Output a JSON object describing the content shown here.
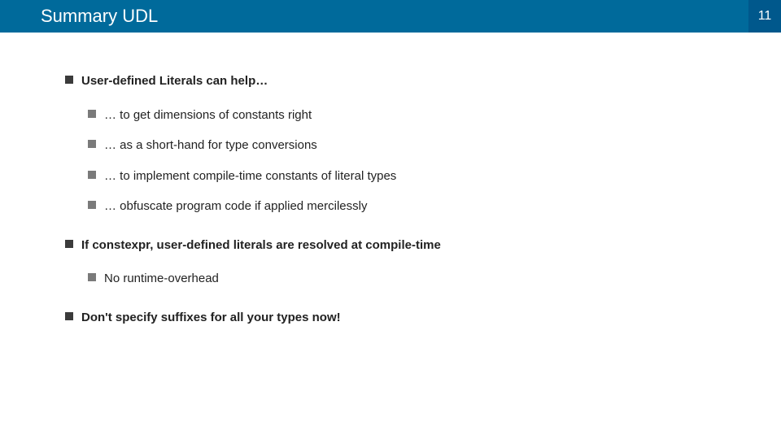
{
  "header": {
    "title": "Summary UDL",
    "page_number": "11"
  },
  "bullets": {
    "top1": "User-defined Literals can help…",
    "sub1a": "… to get dimensions of constants right",
    "sub1b": "… as a short-hand for type conversions",
    "sub1c": "… to implement compile-time constants of literal types",
    "sub1d": "… obfuscate program code if applied mercilessly",
    "top2": "If constexpr, user-defined literals are resolved at compile-time",
    "sub2a": "No runtime-overhead",
    "top3": "Don't specify suffixes for all your types now!"
  }
}
